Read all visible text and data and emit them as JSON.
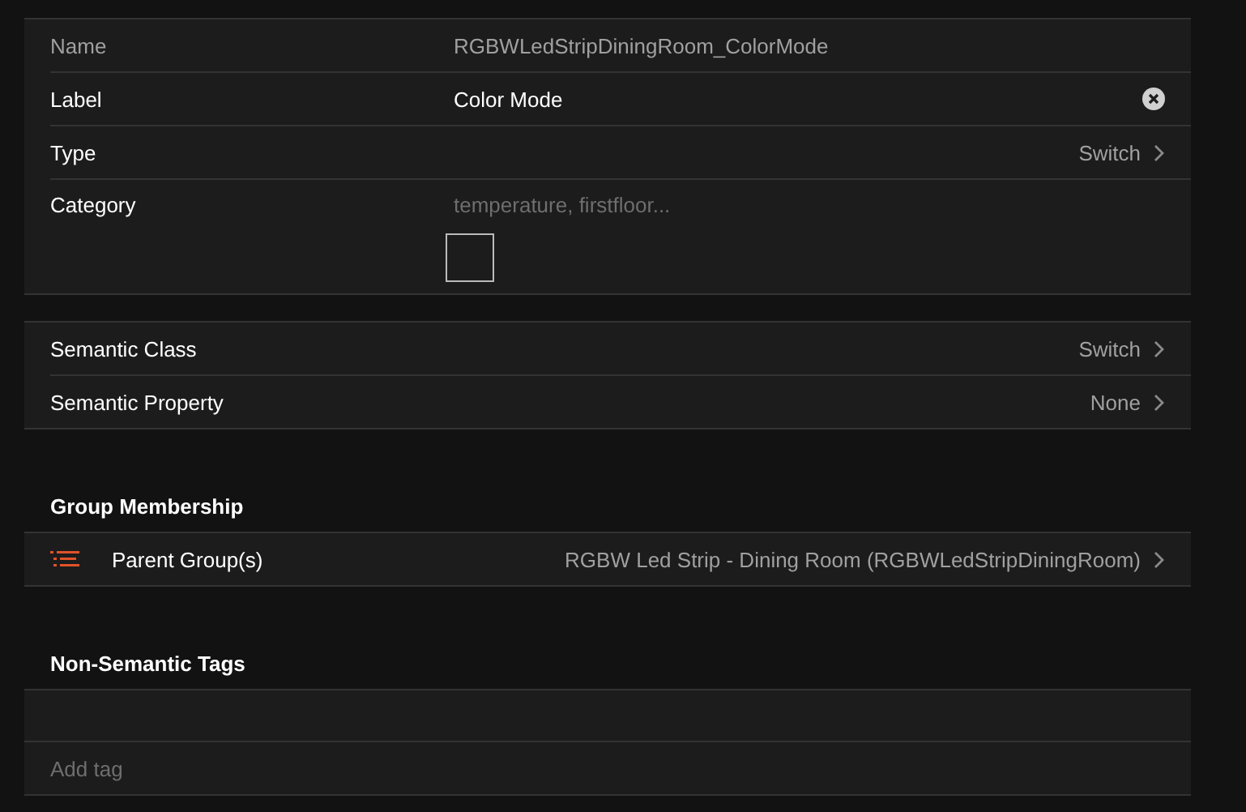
{
  "item_sections": [
    {
      "rows": [
        {
          "kind": "readonly",
          "label": "Name",
          "value": "RGBWLedStripDiningRoom_ColorMode"
        },
        {
          "kind": "input",
          "label": "Label",
          "value": "Color Mode"
        },
        {
          "kind": "link",
          "label": "Type",
          "value": "Switch"
        },
        {
          "kind": "category",
          "label": "Category",
          "placeholder": "temperature, firstfloor..."
        }
      ]
    },
    {
      "rows": [
        {
          "kind": "link",
          "label": "Semantic Class",
          "value": "Switch"
        },
        {
          "kind": "link",
          "label": "Semantic Property",
          "value": "None"
        }
      ]
    }
  ],
  "group_membership": {
    "title": "Group Membership",
    "rows": [
      {
        "label": "Parent Group(s)",
        "value": "RGBW Led Strip - Dining Room (RGBWLedStripDiningRoom)"
      }
    ]
  },
  "tags": {
    "title": "Non-Semantic Tags",
    "placeholder": "Add tag"
  }
}
